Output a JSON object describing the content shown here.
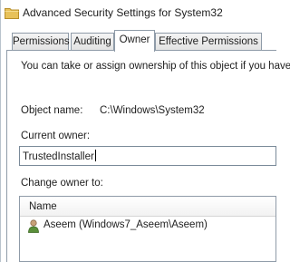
{
  "window": {
    "title": "Advanced Security Settings for System32"
  },
  "tabs": [
    {
      "label": "Permissions"
    },
    {
      "label": "Auditing"
    },
    {
      "label": "Owner"
    },
    {
      "label": "Effective Permissions"
    }
  ],
  "owner_tab": {
    "intro": "You can take or assign ownership of this object if you have",
    "object_name_label": "Object name:",
    "object_name_value": "C:\\Windows\\System32",
    "current_owner_label": "Current owner:",
    "current_owner_value": "TrustedInstaller",
    "change_owner_label": "Change owner to:",
    "list_header": "Name",
    "list_rows": [
      {
        "label": "Aseem (Windows7_Aseem\\Aseem)",
        "icon": "user-icon"
      }
    ]
  },
  "colors": {
    "border": "#8f9ba8",
    "folder": "#e8c25a",
    "user": "#5a8f3a"
  }
}
